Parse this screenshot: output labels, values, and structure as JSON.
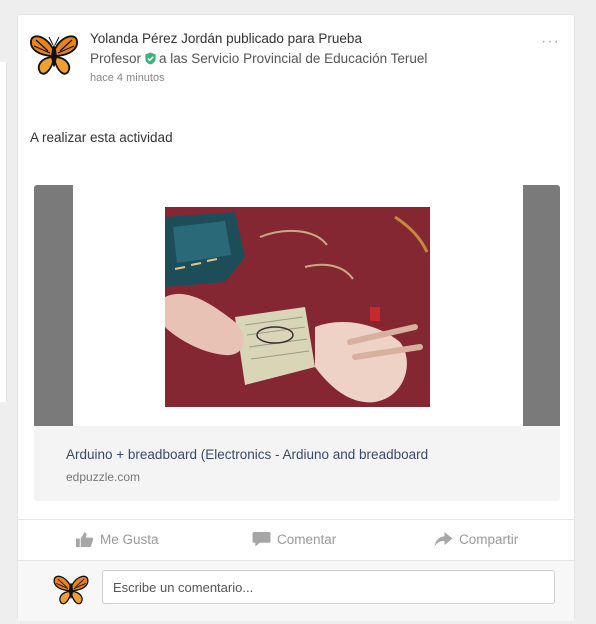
{
  "post": {
    "author_line": "Yolanda Pérez Jordán publicado para Prueba",
    "role": "Profesor",
    "role_suffix": "a las Servicio Provincial de Educación Teruel",
    "time": "hace 4 minutos",
    "more_menu": "···",
    "text": "A realizar esta actividad"
  },
  "link_preview": {
    "title": "Arduino + breadboard (Electronics - Ardiuno and breadboard",
    "domain": "edpuzzle.com"
  },
  "actions": {
    "like": "Me Gusta",
    "comment": "Comentar",
    "share": "Compartir"
  },
  "comment_box": {
    "placeholder": "Escribe un comentario..."
  },
  "colors": {
    "verified": "#3bb37e",
    "link_title": "#3a4a66",
    "action_text": "#9a9a9a"
  },
  "icons": [
    "butterfly-avatar",
    "verified-check-icon",
    "more-options-icon",
    "thumbs-up-icon",
    "speech-bubble-icon",
    "share-arrow-icon"
  ]
}
